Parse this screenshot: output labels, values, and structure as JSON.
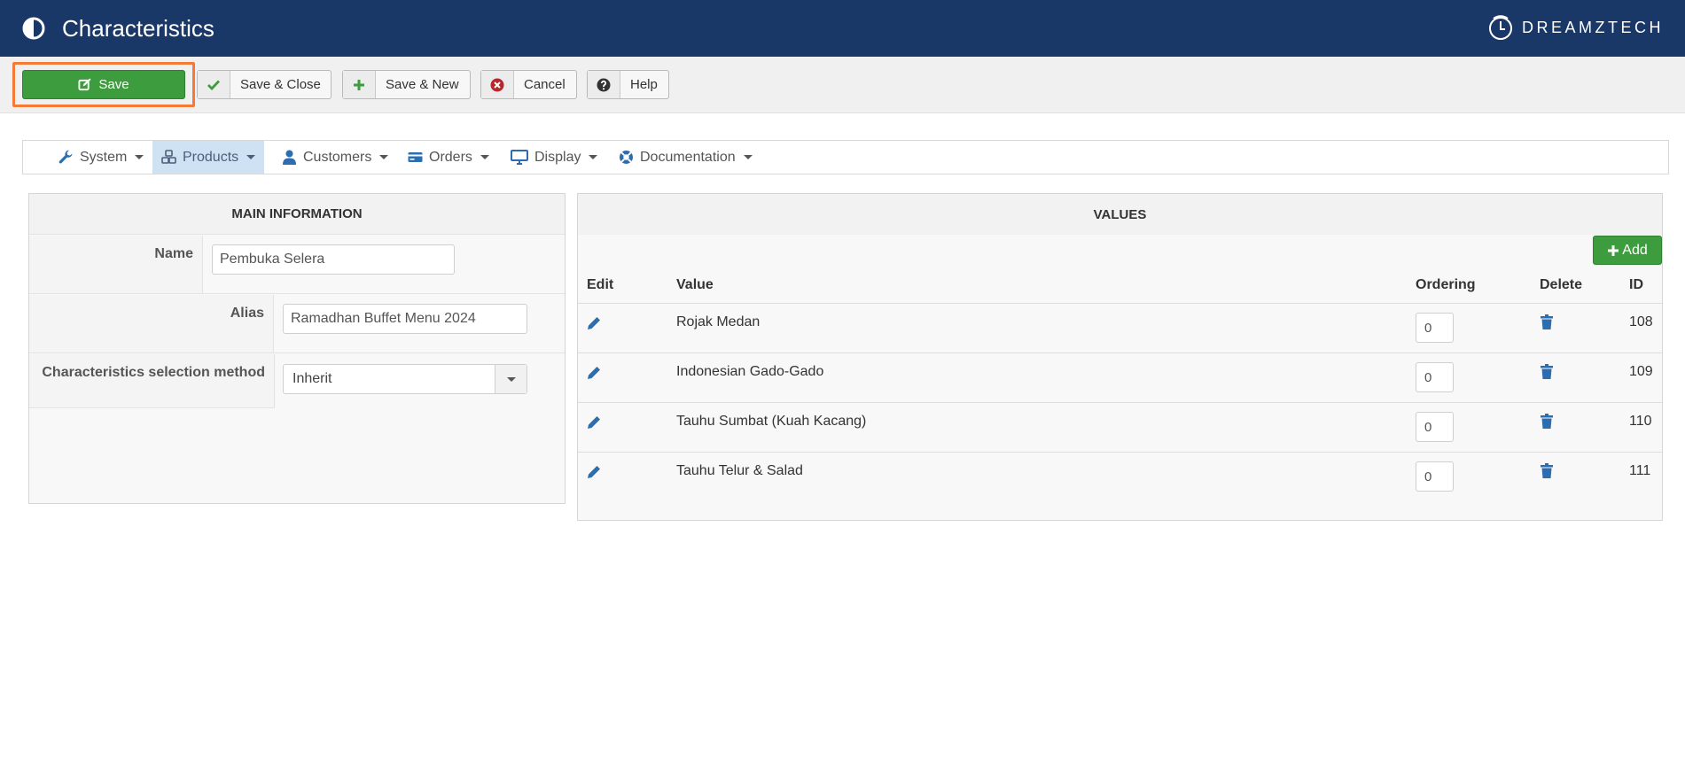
{
  "header": {
    "title": "Characteristics",
    "brand": "DREAMZTECH",
    "colors": {
      "background": "#1a3867",
      "text": "#ffffff"
    }
  },
  "toolbar": {
    "save_label": "Save",
    "save_close_label": "Save & Close",
    "save_new_label": "Save & New",
    "cancel_label": "Cancel",
    "help_label": "Help",
    "colors": {
      "save": "#3d9c3d",
      "highlight": "#f47a36",
      "cancel_icon": "#b7282e"
    }
  },
  "menu": {
    "items": [
      {
        "label": "System",
        "icon": "wrench-icon"
      },
      {
        "label": "Products",
        "icon": "cubes-icon",
        "active": true
      },
      {
        "label": "Customers",
        "icon": "user-icon"
      },
      {
        "label": "Orders",
        "icon": "credit-card-icon"
      },
      {
        "label": "Display",
        "icon": "monitor-icon"
      },
      {
        "label": "Documentation",
        "icon": "lifebuoy-icon"
      }
    ]
  },
  "main_info": {
    "heading": "MAIN INFORMATION",
    "name_label": "Name",
    "name_value": "Pembuka Selera",
    "alias_label": "Alias",
    "alias_value": "Ramadhan Buffet Menu 2024",
    "method_label": "Characteristics selection method",
    "method_value": "Inherit"
  },
  "values": {
    "heading": "VALUES",
    "add_label": "Add",
    "columns": {
      "edit": "Edit",
      "value": "Value",
      "ordering": "Ordering",
      "delete": "Delete",
      "id": "ID"
    },
    "rows": [
      {
        "value": "Rojak Medan",
        "ordering": "0",
        "id": "108"
      },
      {
        "value": "Indonesian Gado-Gado",
        "ordering": "0",
        "id": "109"
      },
      {
        "value": "Tauhu Sumbat (Kuah Kacang)",
        "ordering": "0",
        "id": "110"
      },
      {
        "value": "Tauhu Telur & Salad",
        "ordering": "0",
        "id": "111"
      }
    ],
    "colors": {
      "icon": "#2a6db0"
    }
  }
}
